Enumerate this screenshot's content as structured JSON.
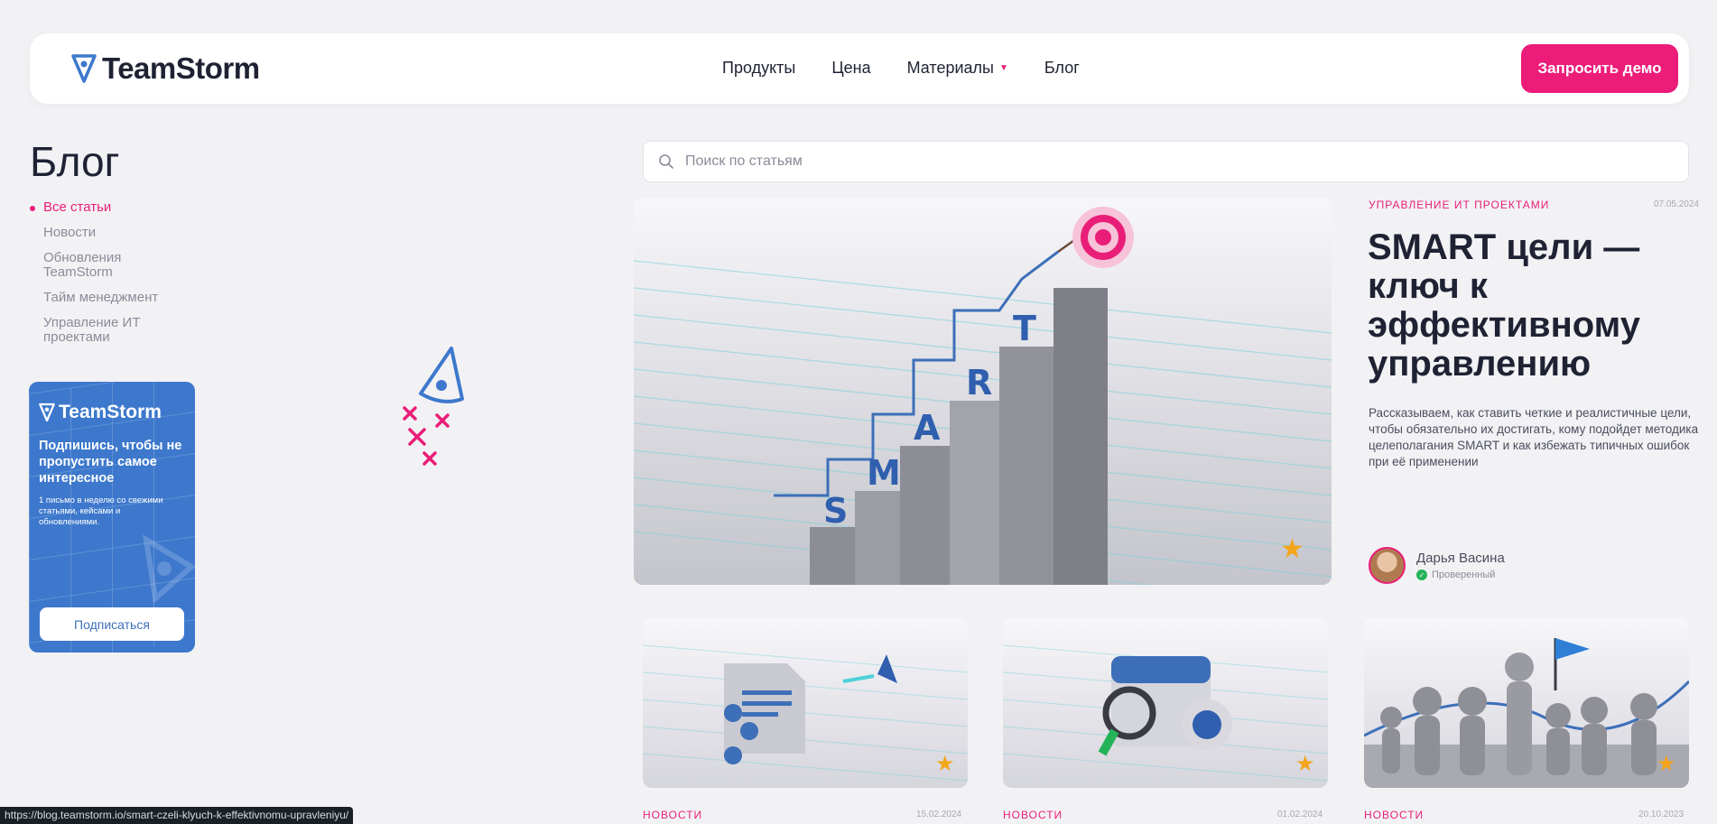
{
  "header": {
    "logo_text": "TeamStorm",
    "nav": [
      {
        "label": "Продукты"
      },
      {
        "label": "Цена"
      },
      {
        "label": "Материалы"
      },
      {
        "label": "Блог"
      }
    ],
    "demo_label": "Запросить демо"
  },
  "sidebar": {
    "title": "Блог",
    "categories": [
      {
        "label": "Все статьи",
        "active": true
      },
      {
        "label": "Новости"
      },
      {
        "label": "Обновления TeamStorm"
      },
      {
        "label": "Тайм менеджмент"
      },
      {
        "label": "Управление ИТ проектами"
      }
    ]
  },
  "subscribe": {
    "logo_text": "TeamStorm",
    "title": "Подпишись, чтобы не пропустить самое интересное",
    "desc": "1 письмо в неделю со свежими статьями, кейсами и обновлениями.",
    "button": "Подписаться"
  },
  "search": {
    "placeholder": "Поиск по статьям"
  },
  "featured": {
    "category": "УПРАВЛЕНИЕ ИТ ПРОЕКТАМИ",
    "date": "07.05.2024",
    "title": "SMART цели — ключ к эффективному управлению",
    "desc": "Рассказываем, как ставить четкие и реалистичные цели, чтобы обязательно их достигать, кому подойдет методика целеполагания SMART и как избежать типичных ошибок при её применении",
    "author": "Дарья Васина",
    "verified": "Проверенный",
    "image_letters": [
      "S",
      "M",
      "A",
      "R",
      "T"
    ]
  },
  "cards": [
    {
      "category": "НОВОСТИ",
      "date": "15.02.2024"
    },
    {
      "category": "НОВОСТИ",
      "date": "01.02.2024"
    },
    {
      "category": "НОВОСТИ",
      "date": "20.10.2023"
    }
  ],
  "status_url": "https://blog.teamstorm.io/smart-czeli-klyuch-k-effektivnomu-upravleniyu/",
  "colors": {
    "accent": "#ec1c79",
    "brand_blue": "#3d78cc",
    "star": "#f4a51c"
  },
  "icons": [
    "logo-icon",
    "chevron-down-icon",
    "search-icon",
    "star-icon",
    "verified-check-icon",
    "rocket-icon"
  ]
}
